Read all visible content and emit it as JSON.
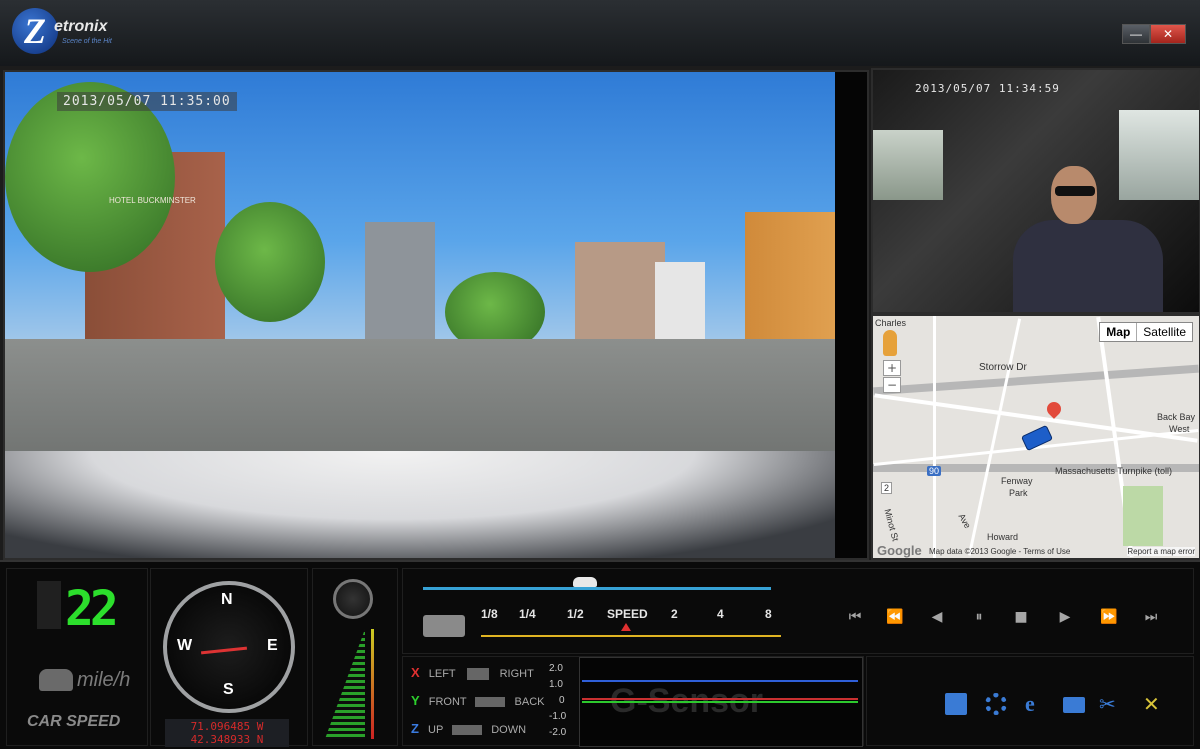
{
  "app": {
    "logo_text": "etronix",
    "logo_letter": "Z",
    "logo_tagline": "Scene of the Hit",
    "window_buttons": {
      "minimize": "—",
      "close": "✕"
    }
  },
  "front_camera": {
    "timestamp": "2013/05/07  11:35:00",
    "sign_text": "HOTEL BUCKMINSTER"
  },
  "cabin_camera": {
    "timestamp": "2013/05/07  11:34:59"
  },
  "map": {
    "view_buttons": [
      "Map",
      "Satellite"
    ],
    "zoom": [
      "+",
      "−"
    ],
    "labels": {
      "charles": "Charles",
      "storrow": "Storrow Dr",
      "back_bay": "Back Bay",
      "west": "West",
      "mass_pike": "Massachusetts Turnpike (toll)",
      "fenway": "Fenway",
      "park": "Park",
      "howard": "Howard",
      "i90": "90",
      "route2": "2",
      "minot": "Minot St",
      "ave": "Ave"
    },
    "google": "Google",
    "attribution": "Map data ©2013 Google - Terms of Use",
    "report": "Report a map error"
  },
  "speedometer": {
    "value": "22",
    "unit": "mile/h",
    "label": "CAR SPEED"
  },
  "compass": {
    "north": "N",
    "south": "S",
    "east": "E",
    "west": "W",
    "longitude": "71.096485  W",
    "latitude": "42.348933  N"
  },
  "playback_speed": {
    "label": "SPEED",
    "ticks": [
      "1/8",
      "1/4",
      "1/2",
      "SPEED",
      "2",
      "4",
      "8"
    ]
  },
  "playback_controls": [
    "⏮",
    "⏪",
    "◀",
    "⏸",
    "■",
    "▶",
    "⏩",
    "⏭"
  ],
  "g_sensor": {
    "watermark": "G-Sensor",
    "x": {
      "letter": "X",
      "neg": "LEFT",
      "pos": "RIGHT"
    },
    "y": {
      "letter": "Y",
      "neg": "FRONT",
      "pos": "BACK"
    },
    "z": {
      "letter": "Z",
      "neg": "UP",
      "pos": "DOWN"
    },
    "scale": [
      "2.0",
      "1.0",
      "0",
      "-1.0",
      "-2.0"
    ]
  },
  "tools": [
    "save-icon",
    "settings-icon",
    "browser-icon",
    "folder-icon",
    "tools-icon",
    "hammer-wrench-icon"
  ]
}
